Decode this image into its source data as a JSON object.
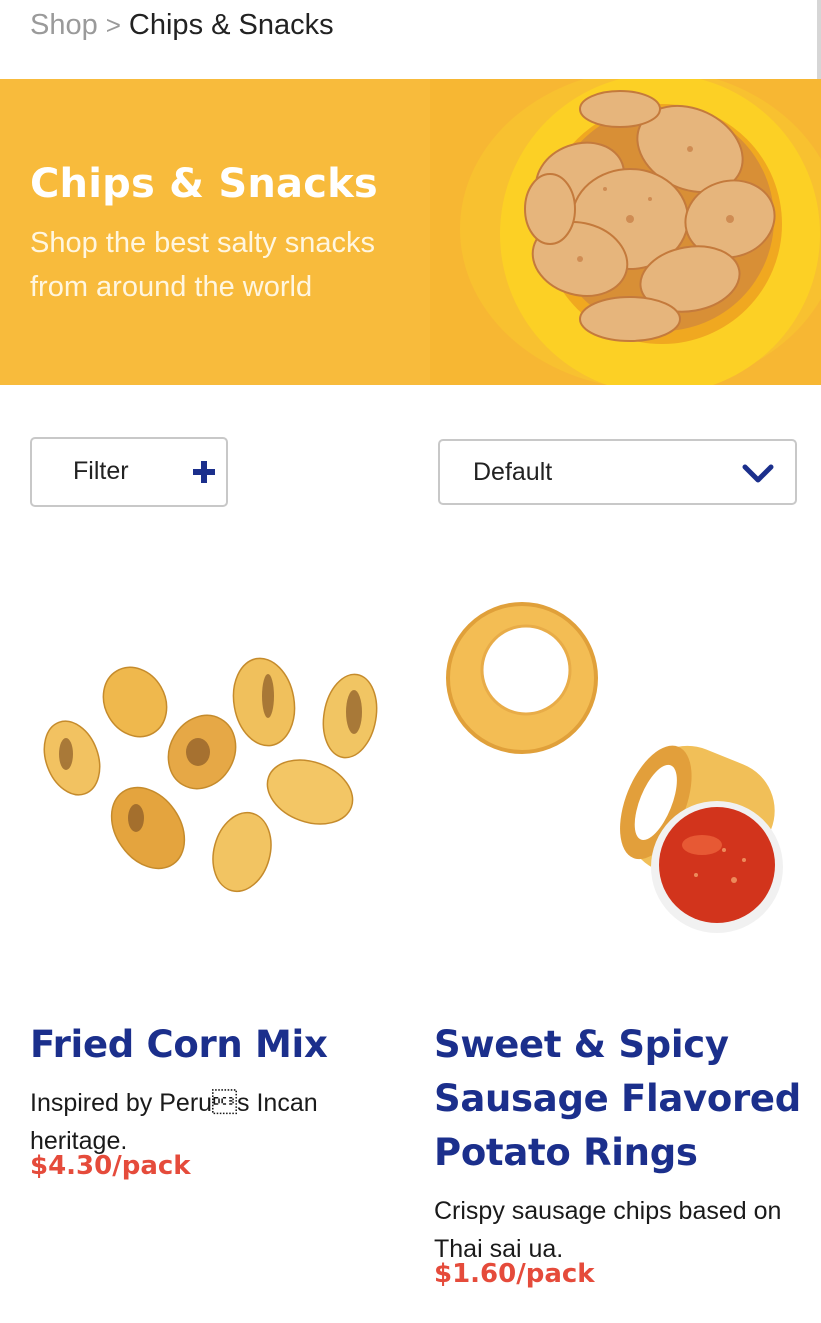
{
  "breadcrumb": {
    "root": "Shop",
    "separator": ">",
    "current": "Chips & Snacks"
  },
  "hero": {
    "title": "Chips & Snacks",
    "subtitle": "Shop the best salty snacks from around the world",
    "background_color": "#f8bb3c",
    "image_icon": "chips-bowl-image"
  },
  "controls": {
    "filter_label": "Filter",
    "filter_icon": "plus-icon",
    "sort_selected": "Default",
    "sort_icon": "chevron-down-icon"
  },
  "colors": {
    "accent": "#1b2f8c",
    "price": "#e54b3b"
  },
  "products": [
    {
      "name": "Fried Corn Mix",
      "description": "Inspired by Peru\u0013s Incan heritage.",
      "price": "$4.30/pack",
      "image_icon": "fried-corn-image"
    },
    {
      "name": "Sweet & Spicy Sausage Flavored Potato Rings",
      "description": "Crispy sausage chips based on Thai sai ua.",
      "price": "$1.60/pack",
      "image_icon": "potato-rings-image"
    }
  ]
}
